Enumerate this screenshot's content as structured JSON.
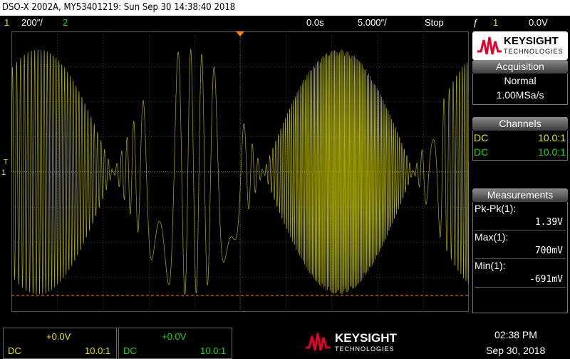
{
  "title": "DSO-X 2002A, MY53401219: Sun Sep 30 14:38:40 2018",
  "status": {
    "ch1_num": "1",
    "ch1_scale": "200″/",
    "ch2_num": "2",
    "time_delay": "0.0s",
    "time_scale": "5.000″/",
    "run_state": "Stop",
    "trigger_icon": "ƒ",
    "trigger_source": "1",
    "trigger_level": "0.0V"
  },
  "markers": {
    "trigger_level_marker": "T",
    "ch1_marker": "1"
  },
  "brand": {
    "name": "KEYSIGHT",
    "sub": "TECHNOLOGIES"
  },
  "acquisition": {
    "header": "Acquisition",
    "mode": "Normal",
    "rate": "1.00MSa/s"
  },
  "channels": {
    "header": "Channels",
    "rows": [
      {
        "coupling": "DC",
        "probe": "10.0:1"
      },
      {
        "coupling": "DC",
        "probe": "10.0:1"
      }
    ]
  },
  "measurements": {
    "header": "Measurements",
    "items": [
      {
        "label": "Pk-Pk(1):",
        "value": "1.39V"
      },
      {
        "label": "Max(1):",
        "value": "700mV"
      },
      {
        "label": "Min(1):",
        "value": "-691mV"
      }
    ]
  },
  "bottom": {
    "ch1": {
      "offset": "+0.0V",
      "coupling": "DC",
      "probe": "10.0:1"
    },
    "ch2": {
      "offset": "+0.0V",
      "coupling": "DC",
      "probe": "10.0:1"
    },
    "time": "02:38 PM",
    "date": "Sep 30, 2018"
  },
  "colors": {
    "ch1": "#e5e500",
    "ch2": "#19d919",
    "trace": "#b8b800",
    "brand_red": "#e4002b",
    "trigger_marker": "#ff8c00"
  }
}
